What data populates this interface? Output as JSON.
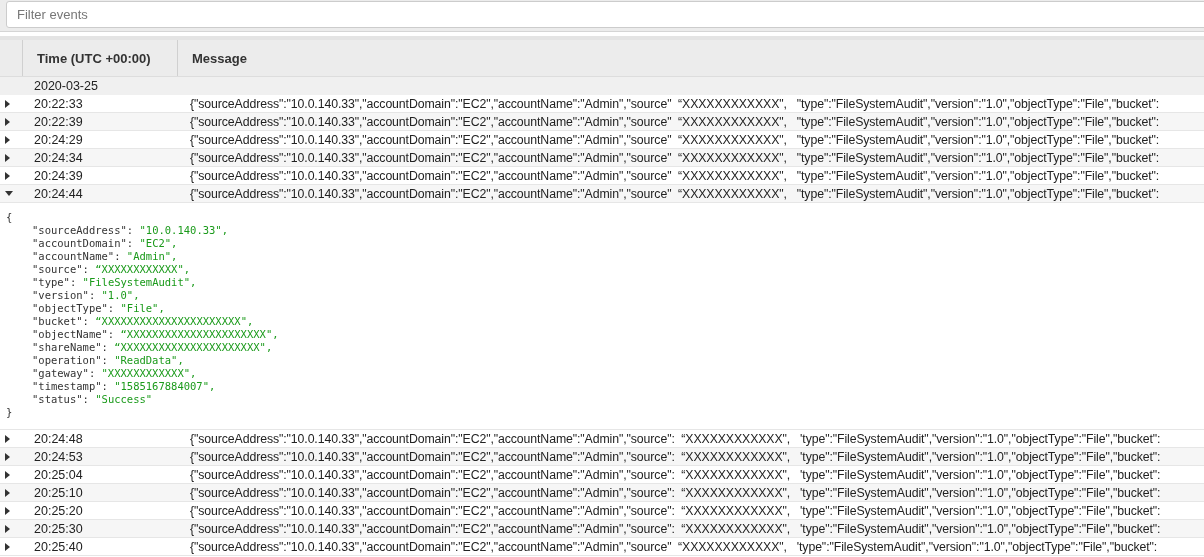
{
  "filter": {
    "placeholder": "Filter events"
  },
  "table": {
    "columns": [
      "Time (UTC +00:00)",
      "Message"
    ],
    "date_group": "2020-03-25",
    "rows": [
      {
        "time": "20:22:33",
        "message": "{\"sourceAddress\":\"10.0.140.33\",\"accountDomain\":\"EC2\",\"accountName\":\"Admin\",\"source\"  “XXXXXXXXXXXX\",   \"type\":\"FileSystemAudit\",\"version\":\"1.0\",\"objectType\":\"File\",\"bucket\":",
        "expanded": false
      },
      {
        "time": "20:22:39",
        "message": "{\"sourceAddress\":\"10.0.140.33\",\"accountDomain\":\"EC2\",\"accountName\":\"Admin\",\"source\"  “XXXXXXXXXXXX\",   \"type\":\"FileSystemAudit\",\"version\":\"1.0\",\"objectType\":\"File\",\"bucket\":",
        "expanded": false
      },
      {
        "time": "20:24:29",
        "message": "{\"sourceAddress\":\"10.0.140.33\",\"accountDomain\":\"EC2\",\"accountName\":\"Admin\",\"source\"  “XXXXXXXXXXXX\",   \"type\":\"FileSystemAudit\",\"version\":\"1.0\",\"objectType\":\"File\",\"bucket\":",
        "expanded": false
      },
      {
        "time": "20:24:34",
        "message": "{\"sourceAddress\":\"10.0.140.33\",\"accountDomain\":\"EC2\",\"accountName\":\"Admin\",\"source\"  “XXXXXXXXXXXX\",   \"type\":\"FileSystemAudit\",\"version\":\"1.0\",\"objectType\":\"File\",\"bucket\":",
        "expanded": false
      },
      {
        "time": "20:24:39",
        "message": "{\"sourceAddress\":\"10.0.140.33\",\"accountDomain\":\"EC2\",\"accountName\":\"Admin\",\"source\"  “XXXXXXXXXXXX\",   \"type\":\"FileSystemAudit\",\"version\":\"1.0\",\"objectType\":\"File\",\"bucket\":",
        "expanded": false
      },
      {
        "time": "20:24:44",
        "message": "{\"sourceAddress\":\"10.0.140.33\",\"accountDomain\":\"EC2\",\"accountName\":\"Admin\",\"source\"  “XXXXXXXXXXXX\",   \"type\":\"FileSystemAudit\",\"version\":\"1.0\",\"objectType\":\"File\",\"bucket\":",
        "expanded": true,
        "detail": {
          "open": "{",
          "close": "}",
          "lines": [
            {
              "key": "\"sourceAddress\":",
              "value": "\"10.0.140.33\","
            },
            {
              "key": "\"accountDomain\":",
              "value": "\"EC2\","
            },
            {
              "key": "\"accountName\":",
              "value": "\"Admin\","
            },
            {
              "key": "\"source\":",
              "value": "“XXXXXXXXXXXX\","
            },
            {
              "key": "\"type\":",
              "value": "\"FileSystemAudit\","
            },
            {
              "key": "\"version\":",
              "value": "\"1.0\","
            },
            {
              "key": "\"objectType\":",
              "value": "\"File\","
            },
            {
              "key": "\"bucket\":",
              "value": "“XXXXXXXXXXXXXXXXXXXXXX\","
            },
            {
              "key": "\"objectName\":",
              "value": "“XXXXXXXXXXXXXXXXXXXXXX\","
            },
            {
              "key": "\"shareName\":",
              "value": "“XXXXXXXXXXXXXXXXXXXXXX\","
            },
            {
              "key": "\"operation\":",
              "value": "\"ReadData\","
            },
            {
              "key": "\"gateway\":",
              "value": "\"XXXXXXXXXXXX\","
            },
            {
              "key": "\"timestamp\":",
              "value": "\"1585167884007\","
            },
            {
              "key": "\"status\":",
              "value": "\"Success\""
            }
          ]
        }
      },
      {
        "time": "20:24:48",
        "message": "{\"sourceAddress\":\"10.0.140.33\",\"accountDomain\":\"EC2\",\"accountName\":\"Admin\",\"source\":  “XXXXXXXXXXXX\",   'type\":\"FileSystemAudit\",\"version\":\"1.0\",\"objectType\":\"File\",\"bucket\":",
        "expanded": false
      },
      {
        "time": "20:24:53",
        "message": "{\"sourceAddress\":\"10.0.140.33\",\"accountDomain\":\"EC2\",\"accountName\":\"Admin\",\"source\":  “XXXXXXXXXXXX\",   'type\":\"FileSystemAudit\",\"version\":\"1.0\",\"objectType\":\"File\",\"bucket\":",
        "expanded": false
      },
      {
        "time": "20:25:04",
        "message": "{\"sourceAddress\":\"10.0.140.33\",\"accountDomain\":\"EC2\",\"accountName\":\"Admin\",\"source\":  “XXXXXXXXXXXX\",   'type\":\"FileSystemAudit\",\"version\":\"1.0\",\"objectType\":\"File\",\"bucket\":",
        "expanded": false
      },
      {
        "time": "20:25:10",
        "message": "{\"sourceAddress\":\"10.0.140.33\",\"accountDomain\":\"EC2\",\"accountName\":\"Admin\",\"source\":  “XXXXXXXXXXXX\",   'type\":\"FileSystemAudit\",\"version\":\"1.0\",\"objectType\":\"File\",\"bucket\":",
        "expanded": false
      },
      {
        "time": "20:25:20",
        "message": "{\"sourceAddress\":\"10.0.140.33\",\"accountDomain\":\"EC2\",\"accountName\":\"Admin\",\"source\":  “XXXXXXXXXXXX\",   'type\":\"FileSystemAudit\",\"version\":\"1.0\",\"objectType\":\"File\",\"bucket\":",
        "expanded": false
      },
      {
        "time": "20:25:30",
        "message": "{\"sourceAddress\":\"10.0.140.33\",\"accountDomain\":\"EC2\",\"accountName\":\"Admin\",\"source\":  “XXXXXXXXXXXX\",   'type\":\"FileSystemAudit\",\"version\":\"1.0\",\"objectType\":\"File\",\"bucket\":",
        "expanded": false
      },
      {
        "time": "20:25:40",
        "message": "{\"sourceAddress\":\"10.0.140.33\",\"accountDomain\":\"EC2\",\"accountName\":\"Admin\",\"source\"  “XXXXXXXXXXXX\",   'type\":\"FileSystemAudit\",\"version\":\"1.0\",\"objectType\":\"File\",\"bucket\":",
        "expanded": false
      }
    ]
  }
}
